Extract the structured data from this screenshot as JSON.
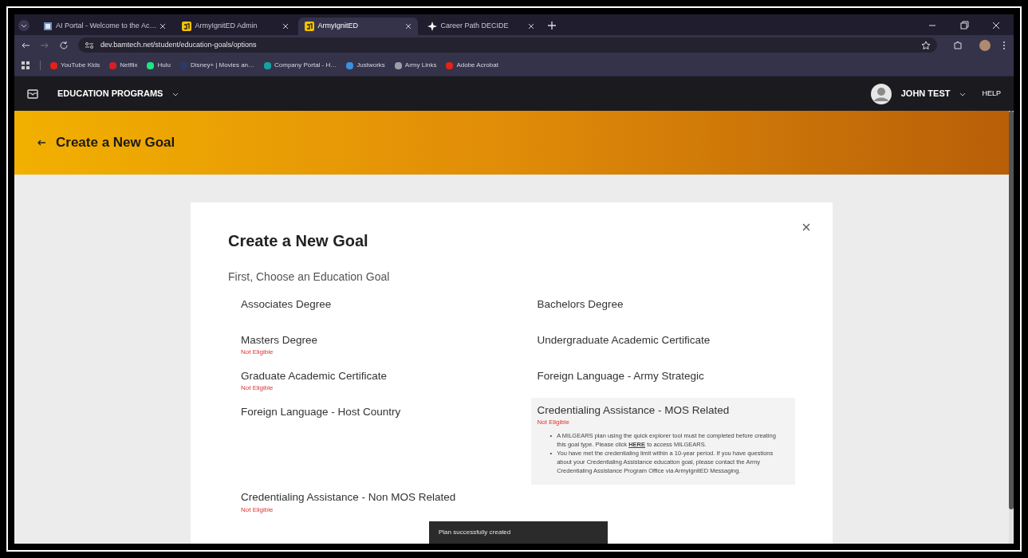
{
  "browser": {
    "tabs": [
      {
        "label": "AI Portal - Welcome to the Ac…",
        "selected": false
      },
      {
        "label": "ArmyIgnitED Admin",
        "selected": false
      },
      {
        "label": "ArmyIgnitED",
        "selected": true
      },
      {
        "label": "Career Path DECIDE",
        "selected": false
      }
    ],
    "url": "dev.bamtech.net/student/education-goals/options",
    "bookmarks": [
      {
        "label": "YouTube Kids",
        "color": "#e62117"
      },
      {
        "label": "Netflix",
        "color": "#d81f26"
      },
      {
        "label": "Hulu",
        "color": "#1ce783"
      },
      {
        "label": "Disney+ | Movies an…",
        "color": "#2a3a6a"
      },
      {
        "label": "Company Portal - H…",
        "color": "#14a3a0"
      },
      {
        "label": "Justworks",
        "color": "#3b8fe0"
      },
      {
        "label": "Army Links",
        "color": "#9aa0a6"
      },
      {
        "label": "Adobe Acrobat",
        "color": "#e2231a"
      }
    ]
  },
  "app_header": {
    "menu": "EDUCATION PROGRAMS",
    "user": "JOHN TEST",
    "help": "HELP"
  },
  "banner": {
    "title": "Create a New Goal"
  },
  "dialog": {
    "title": "Create a New Goal",
    "subtitle": "First, Choose an Education Goal",
    "goals": [
      {
        "name": "Associates Degree",
        "selected": false
      },
      {
        "name": "Bachelors Degree",
        "selected": false
      },
      {
        "name": "Masters Degree",
        "status": "Not Eligible",
        "selected": false
      },
      {
        "name": "Undergraduate Academic Certificate",
        "selected": false
      },
      {
        "name": "Graduate Academic Certificate",
        "status": "Not Eligible",
        "selected": false
      },
      {
        "name": "Foreign Language - Army Strategic",
        "selected": false
      },
      {
        "name": "Foreign Language - Host Country",
        "selected": false
      },
      {
        "name": "Credentialing Assistance - MOS Related",
        "status": "Not Eligible",
        "selected": true,
        "notes": [
          {
            "marker": "•",
            "before": "A MILGEARS plan using the quick explorer tool must be completed before creating this goal type. Please click",
            "link": "HERE",
            "after": "to access MILGEARS."
          },
          {
            "marker": "•",
            "before": "You have met the credentialing limit within a 10-year period. If you have questions about your Credentialing Assistance education goal, please contact the Army Credentialing Assistance Program Office via ArmyIgnitED Messaging."
          }
        ]
      },
      {
        "name": "Credentialing Assistance - Non MOS Related",
        "status": "Not Eligible",
        "selected": false
      }
    ]
  },
  "toast": "Plan successfully created"
}
